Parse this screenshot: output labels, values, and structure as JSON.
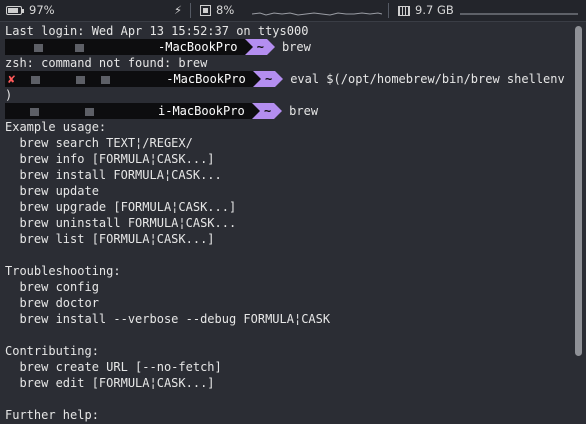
{
  "status_bar": {
    "battery": "97%",
    "power_glyph": "⚡",
    "cpu": "8%",
    "memory": "9.7 GB"
  },
  "terminal": {
    "last_login": "Last login: Wed Apr 13 15:52:37 on ttys000",
    "prompt_host_1": "-MacBookPro",
    "prompt_host_2": "-MacBookPro",
    "prompt_host_3": "i-MacBookPro",
    "prompt_dir": "~",
    "error_mark": "✘",
    "cmd_1": "brew",
    "not_found": "zsh: command not found: brew",
    "cmd_2": "eval $(/opt/homebrew/bin/brew shellenv",
    "cmd_2_cont": ")",
    "cmd_3": "brew",
    "output": [
      "Example usage:",
      "  brew search TEXT¦/REGEX/",
      "  brew info [FORMULA¦CASK...]",
      "  brew install FORMULA¦CASK...",
      "  brew update",
      "  brew upgrade [FORMULA¦CASK...]",
      "  brew uninstall FORMULA¦CASK...",
      "  brew list [FORMULA¦CASK...]",
      "",
      "Troubleshooting:",
      "  brew config",
      "  brew doctor",
      "  brew install --verbose --debug FORMULA¦CASK",
      "",
      "Contributing:",
      "  brew create URL [--no-fetch]",
      "  brew edit [FORMULA¦CASK...]",
      "",
      "Further help:"
    ]
  },
  "colors": {
    "background": "#2b2d34",
    "prompt_user_bg": "#0d0d0f",
    "prompt_dir_bg": "#b48ef0",
    "error": "#ff5a5a"
  }
}
